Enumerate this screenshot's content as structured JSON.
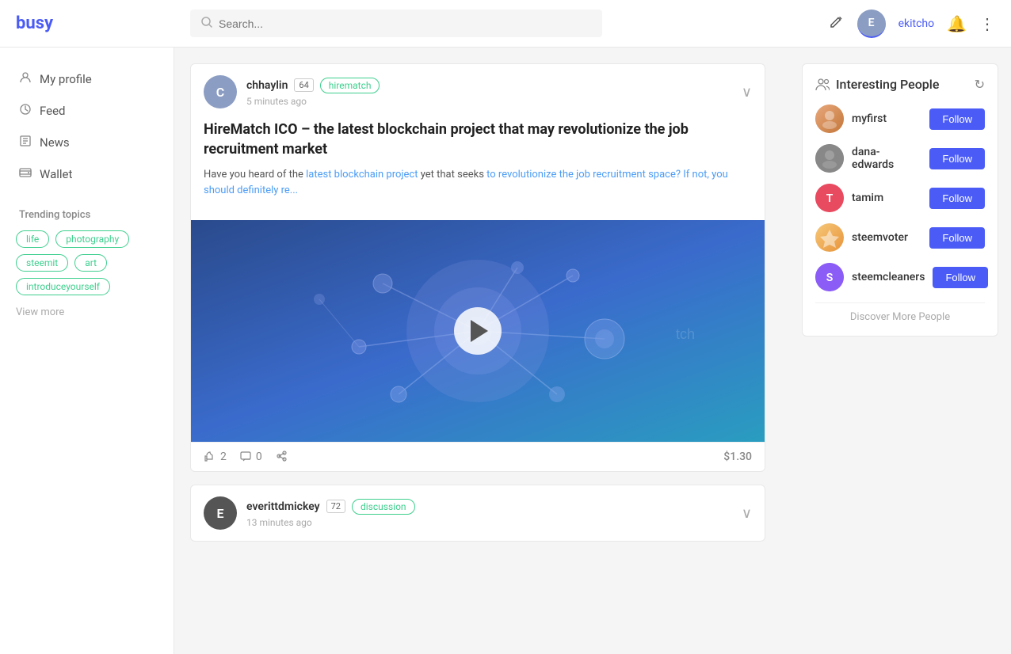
{
  "app": {
    "logo": "busy",
    "search_placeholder": "Search..."
  },
  "header": {
    "username": "ekitcho",
    "edit_icon": "✏",
    "bell_icon": "🔔",
    "dots_icon": "⋮"
  },
  "sidebar": {
    "nav_items": [
      {
        "id": "my-profile",
        "label": "My profile",
        "icon": "👤"
      },
      {
        "id": "feed",
        "label": "Feed",
        "icon": "🕐"
      },
      {
        "id": "news",
        "label": "News",
        "icon": "🖼"
      },
      {
        "id": "wallet",
        "label": "Wallet",
        "icon": "📁"
      }
    ],
    "trending_title": "Trending topics",
    "tags": [
      {
        "id": "life",
        "label": "life"
      },
      {
        "id": "photography",
        "label": "photography"
      },
      {
        "id": "steemit",
        "label": "steemit"
      },
      {
        "id": "art",
        "label": "art"
      },
      {
        "id": "introduceyourself",
        "label": "introduceyourself"
      }
    ],
    "view_more": "View more"
  },
  "posts": [
    {
      "id": "post-1",
      "author": "chhaylin",
      "score": "64",
      "tag": "hirematch",
      "time": "5 minutes ago",
      "title": "HireMatch ICO – the latest blockchain project that may revolutionize the job recruitment market",
      "excerpt": "Have you heard of the latest blockchain project yet that seeks to revolutionize the job recruitment space? If not, you should definitely re...",
      "has_video": true,
      "likes": "2",
      "comments": "0",
      "value": "$1.30"
    },
    {
      "id": "post-2",
      "author": "everittdmickey",
      "score": "72",
      "tag": "discussion",
      "time": "13 minutes ago",
      "title": "",
      "excerpt": "",
      "has_video": false,
      "likes": "",
      "comments": "",
      "value": ""
    }
  ],
  "interesting_people": {
    "title": "Interesting People",
    "people": [
      {
        "id": "myfirst",
        "name": "myfirst",
        "avatar_class": "av-myfirst"
      },
      {
        "id": "dana-edwards",
        "name": "dana-edwards",
        "avatar_class": "av-dana"
      },
      {
        "id": "tamim",
        "name": "tamim",
        "avatar_class": "av-tamim"
      },
      {
        "id": "steemvoter",
        "name": "steemvoter",
        "avatar_class": "av-steemvoter"
      },
      {
        "id": "steemcleaners",
        "name": "steemcleaners",
        "avatar_class": "av-steemcleaners"
      }
    ],
    "follow_label": "Follow",
    "discover_more": "Discover More People"
  }
}
